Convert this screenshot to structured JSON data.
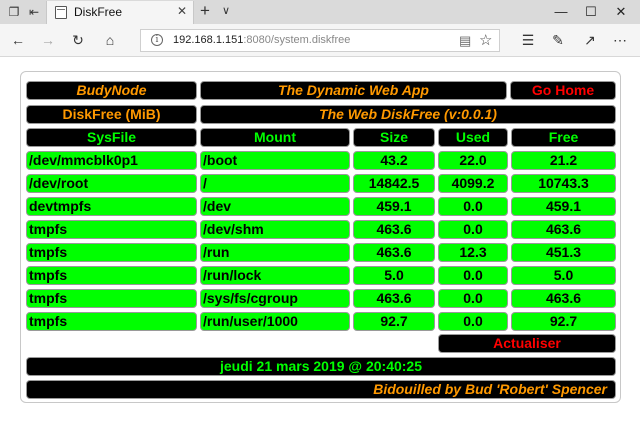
{
  "browser": {
    "tab_title": "DiskFree",
    "url_host": "192.168.1.151",
    "url_rest": ":8080/system.diskfree"
  },
  "page": {
    "node_label": "BudyNode",
    "app_title": "The Dynamic Web App",
    "home_label": "Go Home",
    "section_label": "DiskFree (MiB)",
    "section_title": "The Web DiskFree (v:0.0.1)",
    "columns": [
      "SysFile",
      "Mount",
      "Size",
      "Used",
      "Free"
    ],
    "rows": [
      [
        "/dev/mmcblk0p1",
        "/boot",
        "43.2",
        "22.0",
        "21.2"
      ],
      [
        "/dev/root",
        "/",
        "14842.5",
        "4099.2",
        "10743.3"
      ],
      [
        "devtmpfs",
        "/dev",
        "459.1",
        "0.0",
        "459.1"
      ],
      [
        "tmpfs",
        "/dev/shm",
        "463.6",
        "0.0",
        "463.6"
      ],
      [
        "tmpfs",
        "/run",
        "463.6",
        "12.3",
        "451.3"
      ],
      [
        "tmpfs",
        "/run/lock",
        "5.0",
        "0.0",
        "5.0"
      ],
      [
        "tmpfs",
        "/sys/fs/cgroup",
        "463.6",
        "0.0",
        "463.6"
      ],
      [
        "tmpfs",
        "/run/user/1000",
        "92.7",
        "0.0",
        "92.7"
      ]
    ],
    "refresh_label": "Actualiser",
    "timestamp": "jeudi 21 mars 2019 @ 20:40:25",
    "footer": "Bidouilled by Bud 'Robert' Spencer"
  },
  "colors": {
    "header_text": "#ff9900",
    "column_text": "#00ff00",
    "row_bg": "#00ff00",
    "alert_text": "#ff0000"
  }
}
